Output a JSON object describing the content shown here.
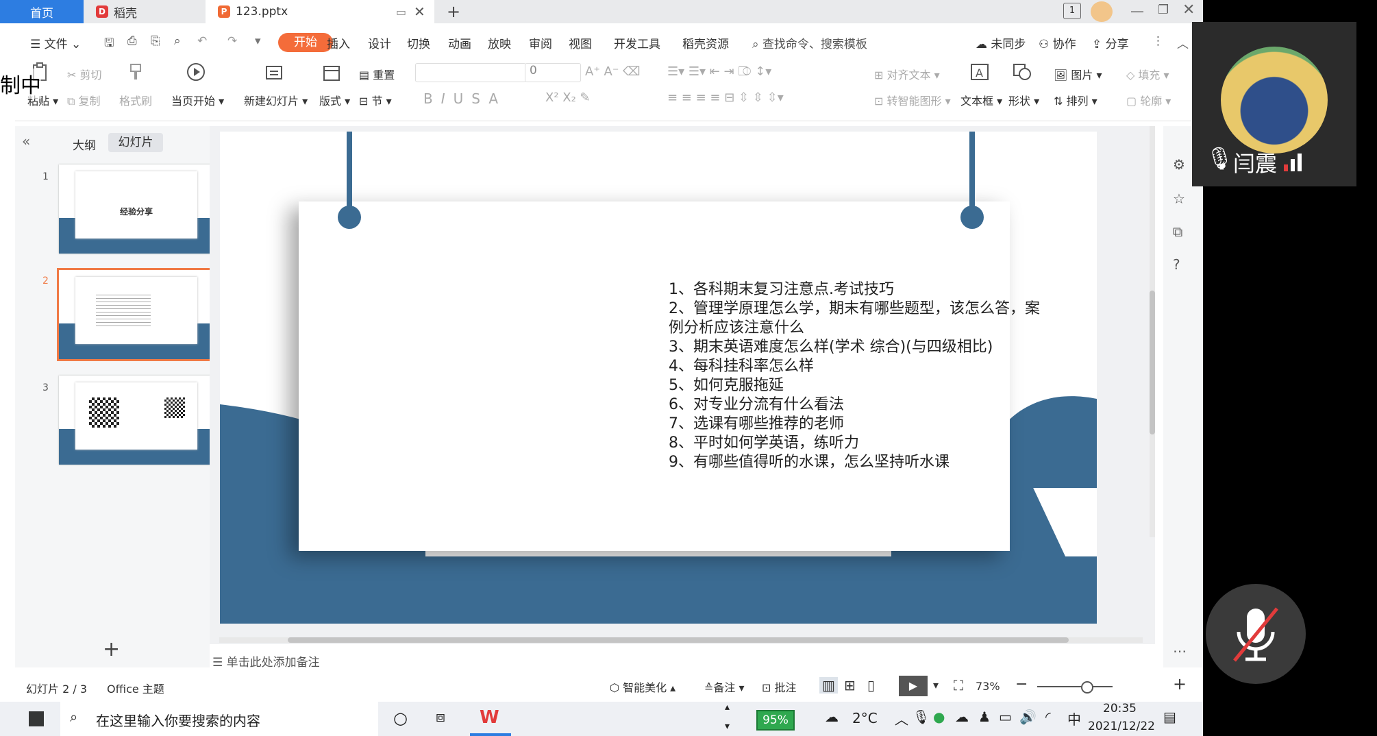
{
  "tabs": {
    "home": "首页",
    "daoke": "稻壳",
    "file": "123.pptx"
  },
  "menu": {
    "file": "文件",
    "items": [
      "开始",
      "插入",
      "设计",
      "切换",
      "动画",
      "放映",
      "审阅",
      "视图",
      "开发工具",
      "稻壳资源"
    ],
    "search": "查找命令、搜索模板",
    "unsynced": "未同步",
    "collaborate": "协作",
    "share": "分享"
  },
  "ribbon": {
    "paste": "粘贴",
    "cut": "剪切",
    "copy": "复制",
    "format_painter": "格式刷",
    "play_from_current": "当页开始",
    "new_slide": "新建幻灯片",
    "layout": "版式",
    "reset": "重置",
    "section": "节",
    "font_size_value": "0",
    "align_text": "对齐文本",
    "smart_art": "转智能图形",
    "text_box": "文本框",
    "shape": "形状",
    "picture": "图片",
    "arrange": "排列",
    "fill": "填充",
    "outline": "轮廓"
  },
  "left_panel": {
    "outline_tab": "大纲",
    "slides_tab": "幻灯片",
    "thumbs": [
      {
        "num": "1",
        "title": "经验分享"
      },
      {
        "num": "2"
      },
      {
        "num": "3"
      }
    ],
    "add": "+"
  },
  "slide": {
    "lines": [
      "1、各科期末复习注意点.考试技巧",
      "2、管理学原理怎么学，期末有哪些题型，该怎么答，案",
      "例分析应该注意什么",
      "3、期末英语难度怎么样(学术 综合)(与四级相比)",
      "4、每科挂科率怎么样",
      "5、如何克服拖延",
      "6、对专业分流有什么看法",
      "7、选课有哪些推荐的老师",
      "8、平时如何学英语，练听力",
      "9、有哪些值得听的水课，怎么坚持听水课"
    ],
    "accent_color": "#3b6b92"
  },
  "notes_placeholder": "单击此处添加备注",
  "status": {
    "slide_info": "幻灯片 2 / 3",
    "theme": "Office 主题",
    "beautify": "智能美化",
    "notes": "备注",
    "comment": "批注",
    "zoom": "73%"
  },
  "taskbar": {
    "search_placeholder": "在这里输入你要搜索的内容",
    "battery": "95%",
    "temperature": "2°C",
    "ime": "中",
    "time": "20:35",
    "date": "2021/12/22"
  },
  "overlay": {
    "recording": "制中",
    "speaker_name": "闫震"
  }
}
